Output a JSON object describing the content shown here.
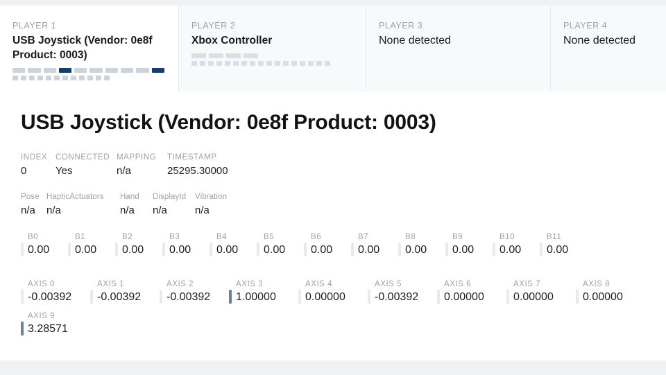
{
  "tabs": [
    {
      "player_label": "PLAYER 1",
      "name": "USB Joystick (Vendor: 0e8f Product: 0003)",
      "active": true,
      "axes_indicators": [
        0,
        0,
        0,
        1,
        0,
        0,
        0,
        0,
        0,
        1
      ],
      "button_indicators": [
        0,
        0,
        0,
        0,
        0,
        0,
        0,
        0,
        0,
        0,
        0,
        0
      ]
    },
    {
      "player_label": "PLAYER 2",
      "name": "Xbox Controller",
      "active": false,
      "axes_indicators": [
        0,
        0,
        0,
        0
      ],
      "button_indicators": [
        0,
        0,
        0,
        0,
        0,
        0,
        0,
        0,
        0,
        0,
        0,
        0,
        0,
        0,
        0,
        0,
        0
      ]
    },
    {
      "player_label": "PLAYER 3",
      "name": "None detected",
      "active": false,
      "axes_indicators": [],
      "button_indicators": []
    },
    {
      "player_label": "PLAYER 4",
      "name": "None detected",
      "active": false,
      "axes_indicators": [],
      "button_indicators": []
    }
  ],
  "detail": {
    "title": "USB Joystick (Vendor: 0e8f Product: 0003)",
    "meta_primary": [
      {
        "label": "INDEX",
        "value": "0"
      },
      {
        "label": "CONNECTED",
        "value": "Yes"
      },
      {
        "label": "MAPPING",
        "value": "n/a"
      },
      {
        "label": "TIMESTAMP",
        "value": "25295.30000"
      }
    ],
    "meta_secondary": [
      {
        "label": "Pose",
        "value": "n/a"
      },
      {
        "label": "HapticActuators",
        "value": "n/a"
      },
      {
        "label": "Hand",
        "value": "n/a"
      },
      {
        "label": "DisplayId",
        "value": "n/a"
      },
      {
        "label": "Vibration",
        "value": "n/a"
      }
    ],
    "buttons": [
      {
        "label": "B0",
        "value": "0.00",
        "level": 0
      },
      {
        "label": "B1",
        "value": "0.00",
        "level": 0
      },
      {
        "label": "B2",
        "value": "0.00",
        "level": 0
      },
      {
        "label": "B3",
        "value": "0.00",
        "level": 0
      },
      {
        "label": "B4",
        "value": "0.00",
        "level": 0
      },
      {
        "label": "B5",
        "value": "0.00",
        "level": 0
      },
      {
        "label": "B6",
        "value": "0.00",
        "level": 0
      },
      {
        "label": "B7",
        "value": "0.00",
        "level": 0
      },
      {
        "label": "B8",
        "value": "0.00",
        "level": 0
      },
      {
        "label": "B9",
        "value": "0.00",
        "level": 0
      },
      {
        "label": "B10",
        "value": "0.00",
        "level": 0
      },
      {
        "label": "B11",
        "value": "0.00",
        "level": 0
      }
    ],
    "axes": [
      {
        "label": "AXIS 0",
        "value": "-0.00392",
        "level": 0
      },
      {
        "label": "AXIS 1",
        "value": "-0.00392",
        "level": 0
      },
      {
        "label": "AXIS 2",
        "value": "-0.00392",
        "level": 0
      },
      {
        "label": "AXIS 3",
        "value": "1.00000",
        "level": 1
      },
      {
        "label": "AXIS 4",
        "value": "0.00000",
        "level": 0
      },
      {
        "label": "AXIS 5",
        "value": "-0.00392",
        "level": 0
      },
      {
        "label": "AXIS 6",
        "value": "0.00000",
        "level": 0
      },
      {
        "label": "AXIS 7",
        "value": "0.00000",
        "level": 0
      },
      {
        "label": "AXIS 8",
        "value": "0.00000",
        "level": 0
      },
      {
        "label": "AXIS 9",
        "value": "3.28571",
        "level": 1
      }
    ]
  },
  "colors": {
    "page_background": "#eef2f5",
    "card_background": "#ffffff",
    "tab_inactive_background": "#f7fafb",
    "label_gray": "#9aa2ab",
    "value_black": "#1b1d20",
    "indicator_off": "#ccd3db",
    "indicator_on": "#0f3d77",
    "bar_idle": "#e7ebf0",
    "bar_active": "#6b8099"
  }
}
